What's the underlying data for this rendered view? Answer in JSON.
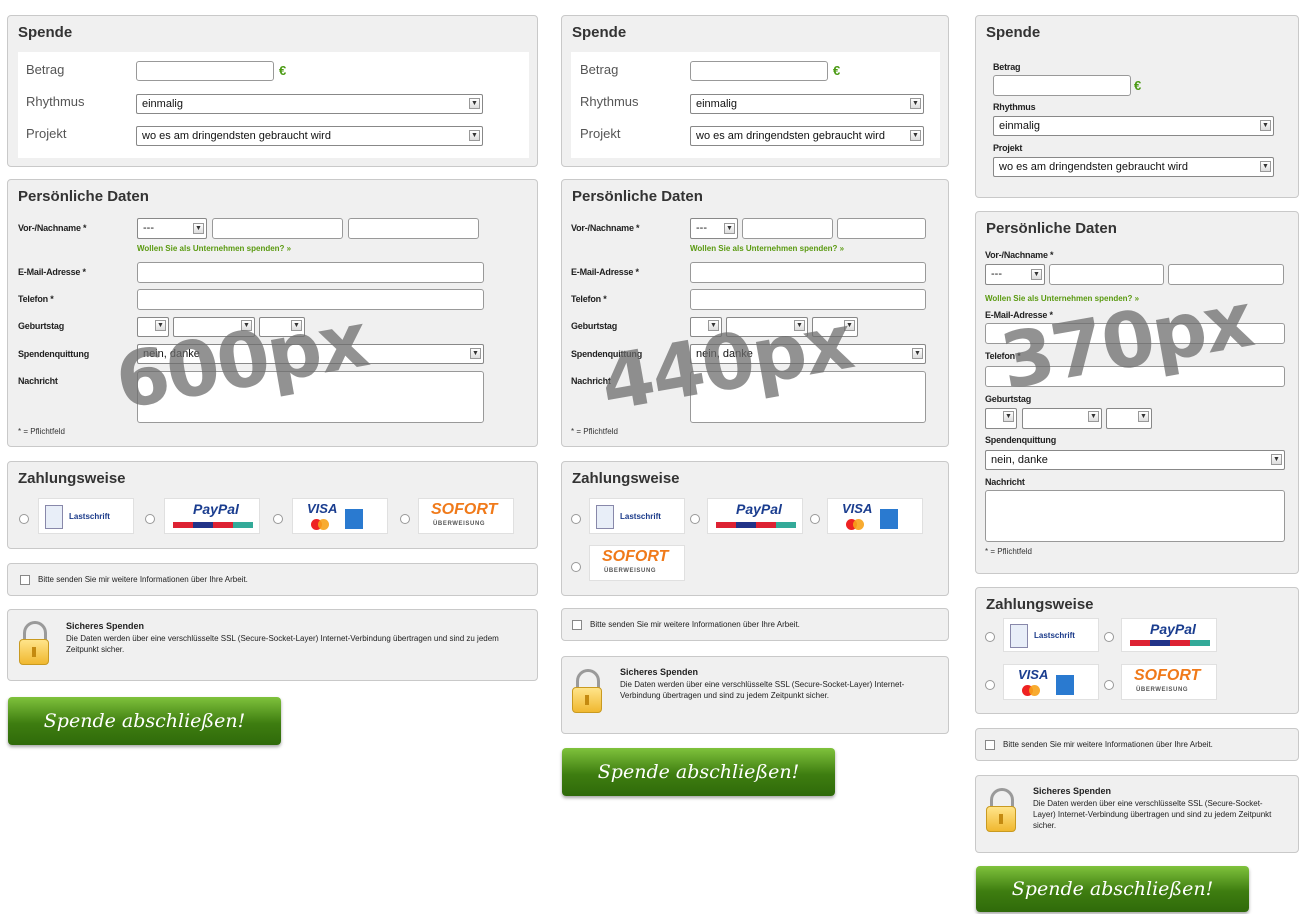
{
  "spende": {
    "title": "Spende",
    "betrag_label": "Betrag",
    "currency": "€",
    "rhythmus_label": "Rhythmus",
    "rhythmus_value": "einmalig",
    "projekt_label": "Projekt",
    "projekt_value": "wo es am dringendsten gebraucht wird"
  },
  "personal": {
    "title": "Persönliche Daten",
    "name_label": "Vor-/Nachname *",
    "salutation_value": "---",
    "company_link": "Wollen Sie als Unternehmen spenden? »",
    "email_label": "E-Mail-Adresse *",
    "phone_label": "Telefon *",
    "birthday_label": "Geburtstag",
    "receipt_label": "Spendenquittung",
    "receipt_value": "nein, danke",
    "message_label": "Nachricht",
    "required_note": "* = Pflichtfeld"
  },
  "payment": {
    "title": "Zahlungsweise",
    "methods": [
      "Lastschrift",
      "PayPal",
      "VISA",
      "SOFORT"
    ],
    "sofort_sub": "ÜBERWEISUNG"
  },
  "newsletter_label": "Bitte senden Sie mir weitere Informationen über Ihre Arbeit.",
  "security": {
    "title": "Sicheres Spenden",
    "text": "Die Daten werden über eine verschlüsselte SSL (Secure-Socket-Layer) Internet-Verbindung übertragen und sind zu jedem Zeitpunkt sicher."
  },
  "submit_label": "Spende abschließen!",
  "watermarks": [
    "600px",
    "440px",
    "370px"
  ]
}
